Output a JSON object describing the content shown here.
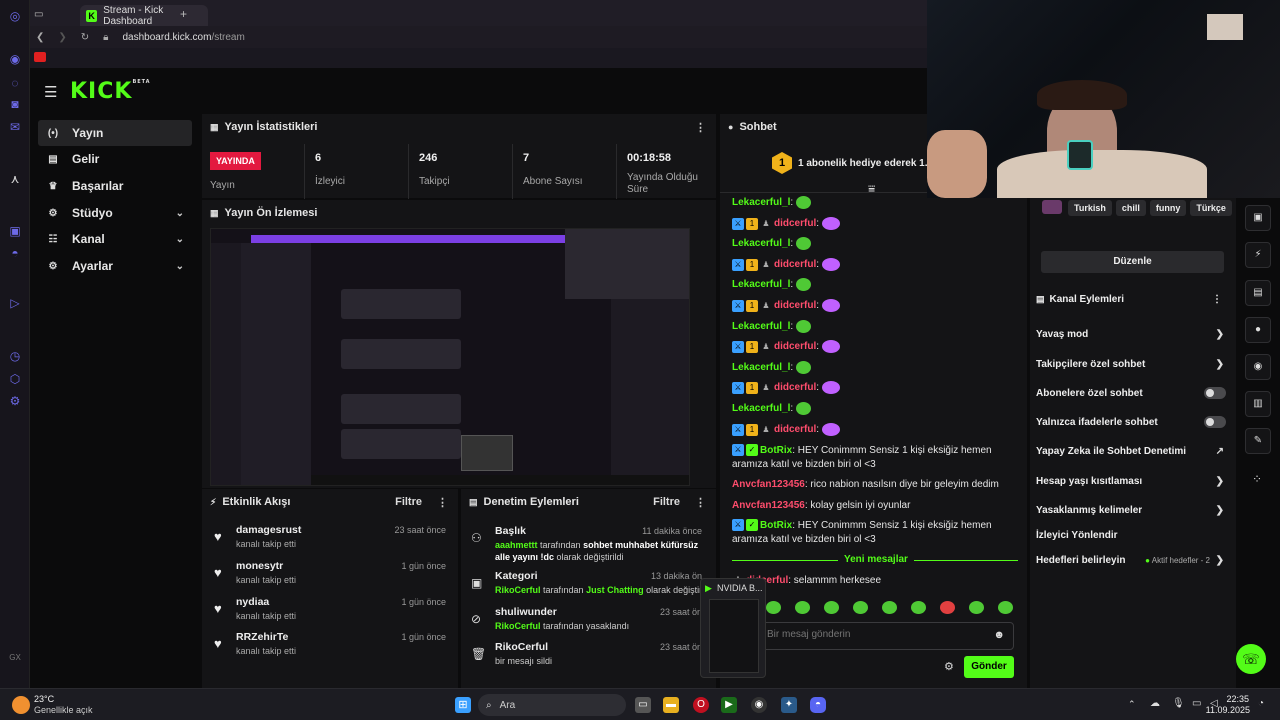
{
  "browser": {
    "tab_title": "Stream - Kick Dashboard",
    "url_domain": "dashboard.kick.com",
    "url_path": "/stream",
    "new_tab": "+"
  },
  "brand": {
    "logo": "KICK",
    "logo_sup": "BETA",
    "accent": "#53fc18"
  },
  "sidebar": {
    "items": [
      {
        "label": "Yayın",
        "icon": "broadcast-icon",
        "glyph": "(•)",
        "active": true
      },
      {
        "label": "Gelir",
        "icon": "revenue-icon",
        "glyph": "▤"
      },
      {
        "label": "Başarılar",
        "icon": "trophy-icon",
        "glyph": "♛"
      },
      {
        "label": "Stüdyo",
        "icon": "studio-icon",
        "glyph": "⚙"
      },
      {
        "label": "Kanal",
        "icon": "channel-icon",
        "glyph": "☷"
      },
      {
        "label": "Ayarlar",
        "icon": "settings-icon",
        "glyph": "⚙"
      }
    ]
  },
  "stats": {
    "title": "Yayın İstatistikleri",
    "live": "YAYINDA",
    "live_label": "Yayın",
    "items": [
      {
        "value": "6",
        "label": "İzleyici"
      },
      {
        "value": "246",
        "label": "Takipçi"
      },
      {
        "value": "7",
        "label": "Abone Sayısı"
      },
      {
        "value": "00:18:58",
        "label": "Yayında Olduğu Süre"
      }
    ]
  },
  "preview": {
    "title": "Yayın Ön İzlemesi"
  },
  "activity": {
    "title": "Etkinlik Akışı",
    "filter": "Filtre",
    "rows": [
      {
        "name": "damagesrust",
        "sub": "kanalı takip etti",
        "time": "23 saat önce"
      },
      {
        "name": "monesytr",
        "sub": "kanalı takip etti",
        "time": "1 gün önce"
      },
      {
        "name": "nydiaa",
        "sub": "kanalı takip etti",
        "time": "1 gün önce"
      },
      {
        "name": "RRZehirTe",
        "sub": "kanalı takip etti",
        "time": "1 gün önce"
      }
    ]
  },
  "moderation": {
    "title": "Denetim Eylemleri",
    "filter": "Filtre",
    "rows": [
      {
        "title": "Başlık",
        "time": "11 dakika önce",
        "user": "aaahmettt",
        "mid": " tarafından ",
        "val": "sohbet muhhabet küfürsüz alle yayını !dc",
        "end": " olarak değiştirildi"
      },
      {
        "title": "Kategori",
        "time": "13 dakika ön",
        "user": "RikoCerful",
        "mid": " tarafından ",
        "val": "Just Chatting",
        "end": " olarak değiştirildi"
      },
      {
        "title": "shuliwunder",
        "time": "23 saat ön",
        "user": "RikoCerful",
        "mid": " tarafından yasaklandı",
        "val": "",
        "end": ""
      },
      {
        "title": "RikoCerful",
        "time": "23 saat ön",
        "user": "",
        "mid": "bir mesajı sildi",
        "val": "",
        "end": ""
      }
    ]
  },
  "chat": {
    "title": "Sohbet",
    "pinned": "1 abonelik hediye ederek 1. sıra",
    "pinned_rank": "1",
    "new_messages": "Yeni mesajlar",
    "placeholder": "Bir mesaj gönderin",
    "send": "Gönder",
    "messages": [
      {
        "user": "Lekacerful_l",
        "color": "green",
        "badges": [],
        "text": ""
      },
      {
        "user": "didcerful",
        "color": "red",
        "badges": [
          "mod",
          "sub",
          "gift"
        ],
        "text": ""
      },
      {
        "user": "Lekacerful_l",
        "color": "green",
        "badges": [],
        "text": ""
      },
      {
        "user": "didcerful",
        "color": "red",
        "badges": [
          "mod",
          "sub",
          "gift"
        ],
        "text": ""
      },
      {
        "user": "Lekacerful_l",
        "color": "green",
        "badges": [],
        "text": ""
      },
      {
        "user": "didcerful",
        "color": "red",
        "badges": [
          "mod",
          "sub",
          "gift"
        ],
        "text": ""
      },
      {
        "user": "Lekacerful_l",
        "color": "green",
        "badges": [],
        "text": ""
      },
      {
        "user": "didcerful",
        "color": "red",
        "badges": [
          "mod",
          "sub",
          "gift"
        ],
        "text": ""
      },
      {
        "user": "Lekacerful_l",
        "color": "green",
        "badges": [],
        "text": ""
      },
      {
        "user": "didcerful",
        "color": "red",
        "badges": [
          "mod",
          "sub",
          "gift"
        ],
        "text": ""
      },
      {
        "user": "Lekacerful_l",
        "color": "green",
        "badges": [],
        "text": ""
      },
      {
        "user": "didcerful",
        "color": "red",
        "badges": [
          "mod",
          "sub",
          "gift"
        ],
        "text": ""
      }
    ],
    "bot_messages": [
      {
        "user": "BotRix",
        "text": "HEY Conimmm Sensiz 1 kişi eksiğiz hemen aramıza katıl ve bizden biri ol <3"
      },
      {
        "user": "Anvcfan123456",
        "text": "rico nabion nasılsın diye bir geleyim dedim"
      },
      {
        "user": "Anvcfan123456",
        "text": "kolay gelsin iyi oyunlar"
      },
      {
        "user": "BotRix",
        "text": "HEY Conimmm Sensiz 1 kişi eksiğiz hemen aramıza katıl ve bizden biri ol <3"
      }
    ],
    "after_new": {
      "user": "didcerful",
      "text": "selammm herkesee"
    }
  },
  "right_panel": {
    "tags": [
      "Turkish",
      "chill",
      "funny",
      "Türkçe"
    ],
    "edit": "Düzenle",
    "actions_title": "Kanal Eylemleri",
    "actions": [
      {
        "label": "Yavaş mod",
        "kind": "chev"
      },
      {
        "label": "Takipçilere özel sohbet",
        "kind": "chev"
      },
      {
        "label": "Abonelere özel sohbet",
        "kind": "toggle"
      },
      {
        "label": "Yalnızca ifadelerle sohbet",
        "kind": "toggle"
      },
      {
        "label": "Yapay Zeka ile Sohbet Denetimi",
        "kind": "ext"
      },
      {
        "label": "Hesap yaşı kısıtlaması",
        "kind": "chev"
      },
      {
        "label": "Yasaklanmış kelimeler",
        "kind": "chev"
      },
      {
        "label": "İzleyici Yönlendir",
        "kind": "none"
      },
      {
        "label": "Hedefleri belirleyin",
        "kind": "chev",
        "extra": "Aktif hedefler - 2"
      }
    ]
  },
  "nvidia_tip": "NVIDIA B...",
  "taskbar": {
    "weather_temp": "23°C",
    "weather_desc": "Genellikle açık",
    "search": "Ara",
    "time": "22:35",
    "date": "11.09.2025"
  }
}
